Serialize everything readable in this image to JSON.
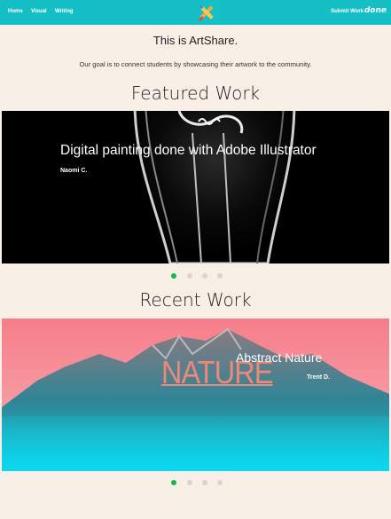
{
  "nav": {
    "home": "Home",
    "visual": "Visual",
    "writing": "Writing",
    "submit": "Submit Work",
    "done": "done"
  },
  "intro": {
    "title": "This is ArtShare.",
    "text": "Our goal is to connect students by showcasing their artwork to the community."
  },
  "featured": {
    "heading": "Featured Work",
    "title": "Digital painting done with Adobe Illustrator",
    "author": "Naomi C.",
    "slide_count": 4,
    "active_index": 0
  },
  "recent": {
    "heading": "Recent Work",
    "overlay_word": "NATURE",
    "title": "Abstract Nature",
    "author": "Trent D.",
    "slide_count": 4,
    "active_index": 0
  },
  "colors": {
    "nav_bg": "#14bfc6",
    "page_bg": "#f8f0e6",
    "dot_active": "#12b848",
    "dot_inactive": "#d6d6d6"
  }
}
